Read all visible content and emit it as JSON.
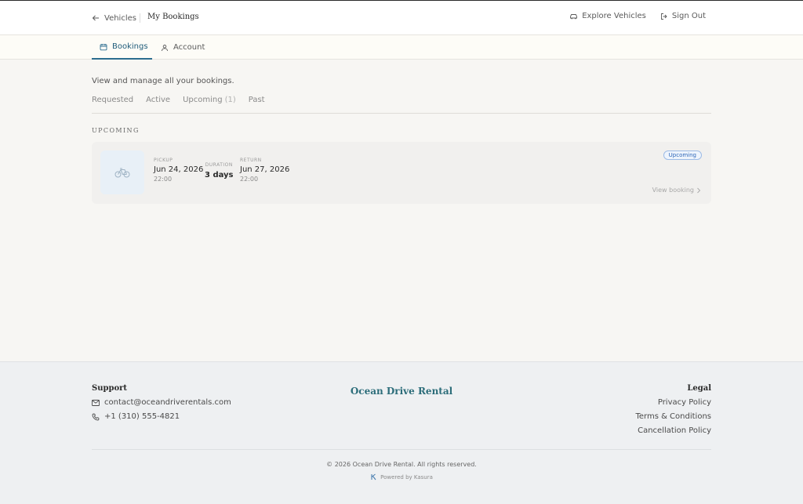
{
  "header": {
    "back_label": "Vehicles",
    "page_title": "My Bookings",
    "explore_label": "Explore Vehicles",
    "signout_label": "Sign Out"
  },
  "tabs": [
    {
      "label": "Bookings",
      "active": true,
      "icon": "calendar-icon"
    },
    {
      "label": "Account",
      "active": false,
      "icon": "user-icon"
    }
  ],
  "main": {
    "intro": "View and manage all your bookings.",
    "filters": [
      {
        "label": "Requested"
      },
      {
        "label": "Active"
      },
      {
        "label": "Upcoming",
        "count": "(1)"
      },
      {
        "label": "Past"
      }
    ],
    "section_title": "UPCOMING",
    "booking": {
      "pickup_label": "PICKUP",
      "pickup_date": "Jun 24, 2026",
      "pickup_time": "22:00",
      "duration_label": "DURATION",
      "duration_value": "3 days",
      "return_label": "RETURN",
      "return_date": "Jun 27, 2026",
      "return_time": "22:00",
      "status": "Upcoming",
      "view_label": "View booking"
    }
  },
  "footer": {
    "support_title": "Support",
    "email": "contact@oceandriverentals.com",
    "phone": "+1 (310) 555-4821",
    "brand": "Ocean Drive Rental",
    "legal_title": "Legal",
    "legal_links": [
      "Privacy Policy",
      "Terms & Conditions",
      "Cancellation Policy"
    ],
    "copyright": "© 2026 Ocean Drive Rental. All rights reserved.",
    "powered_by": "Powered by Kasura"
  },
  "colors": {
    "accent": "#2c6d8f",
    "brand": "#2c6d7a",
    "badge": "#2d66b8"
  }
}
